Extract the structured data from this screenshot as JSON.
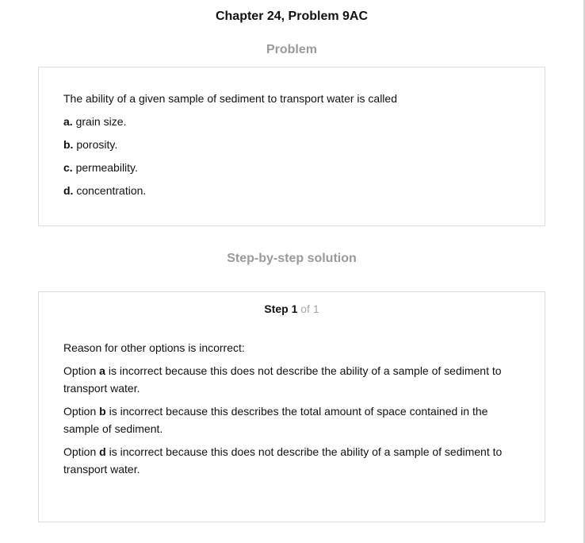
{
  "header": {
    "title": "Chapter 24, Problem 9AC"
  },
  "problem": {
    "heading": "Problem",
    "question": "The ability of a given sample of sediment to transport water is called",
    "options": [
      {
        "letter": "a.",
        "text": "grain size."
      },
      {
        "letter": "b.",
        "text": "porosity."
      },
      {
        "letter": "c.",
        "text": "permeability."
      },
      {
        "letter": "d.",
        "text": "concentration."
      }
    ]
  },
  "solution": {
    "heading": "Step-by-step solution",
    "step_label": "Step 1",
    "step_of": "of 1",
    "intro": "Reason for other options is incorrect:",
    "reasons": [
      {
        "prefix": "Option",
        "letter": "a",
        "text": "is incorrect because this does not describe the ability of a sample of sediment to transport water."
      },
      {
        "prefix": "Option",
        "letter": "b",
        "text": "is incorrect because this describes the total amount of space contained in the sample of sediment."
      },
      {
        "prefix": "Option",
        "letter": "d",
        "text": "is incorrect because this does not describe the ability of a sample of sediment to transport water."
      }
    ]
  }
}
